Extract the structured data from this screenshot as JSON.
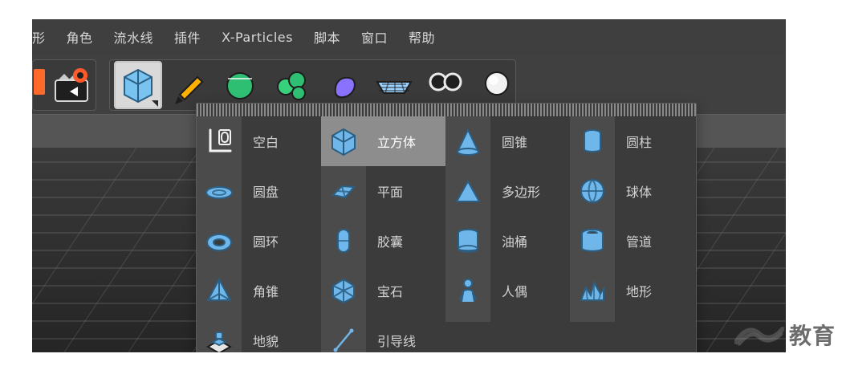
{
  "menubar": {
    "items": [
      {
        "label": "形"
      },
      {
        "label": "角色"
      },
      {
        "label": "流水线"
      },
      {
        "label": "插件"
      },
      {
        "label": "X-Particles"
      },
      {
        "label": "脚本"
      },
      {
        "label": "窗口"
      },
      {
        "label": "帮助"
      }
    ]
  },
  "popup": {
    "columns": [
      {
        "items": [
          {
            "label": "空白",
            "icon": "null-object-icon"
          },
          {
            "label": "圆盘",
            "icon": "disc-icon"
          },
          {
            "label": "圆环",
            "icon": "torus-icon"
          },
          {
            "label": "角锥",
            "icon": "pyramid-icon"
          },
          {
            "label": "地貌",
            "icon": "landscape-icon"
          }
        ]
      },
      {
        "items": [
          {
            "label": "立方体",
            "icon": "cube-icon",
            "selected": true
          },
          {
            "label": "平面",
            "icon": "plane-icon"
          },
          {
            "label": "胶囊",
            "icon": "capsule-icon"
          },
          {
            "label": "宝石",
            "icon": "gem-icon"
          },
          {
            "label": "引导线",
            "icon": "guide-line-icon"
          }
        ]
      },
      {
        "items": [
          {
            "label": "圆锥",
            "icon": "cone-icon"
          },
          {
            "label": "多边形",
            "icon": "polygon-icon"
          },
          {
            "label": "油桶",
            "icon": "oil-tank-icon"
          },
          {
            "label": "人偶",
            "icon": "figure-icon"
          }
        ]
      },
      {
        "items": [
          {
            "label": "圆柱",
            "icon": "cylinder-icon"
          },
          {
            "label": "球体",
            "icon": "sphere-icon"
          },
          {
            "label": "管道",
            "icon": "tube-icon"
          },
          {
            "label": "地形",
            "icon": "terrain-icon"
          }
        ]
      }
    ]
  },
  "watermark": {
    "text": "教育"
  },
  "colors": {
    "app_bg": "#4a4a4a",
    "menu_bg": "#3f3f3f",
    "popup_bg": "#3b3b3b",
    "icon_blue": "#6fb7ea",
    "selected_bg": "#8d8d8d"
  }
}
